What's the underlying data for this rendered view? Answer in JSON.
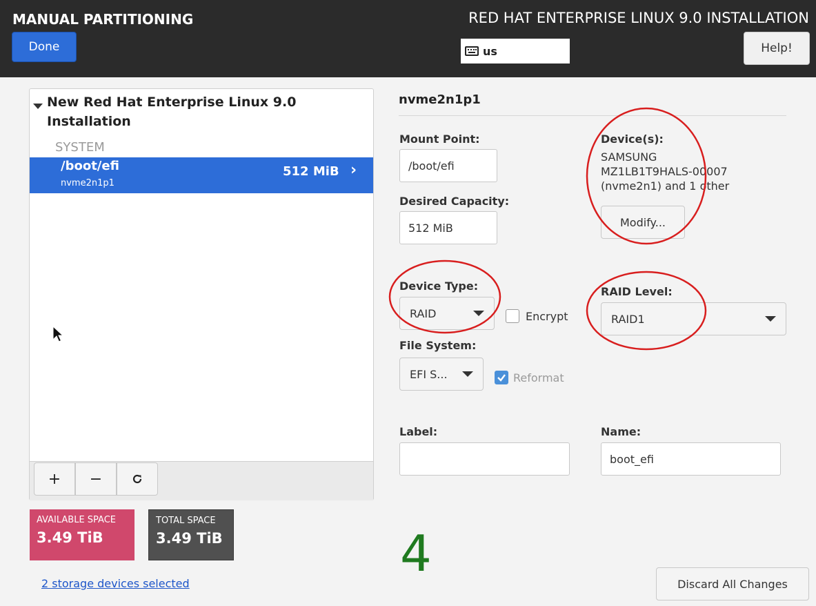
{
  "header": {
    "title": "MANUAL PARTITIONING",
    "product": "RED HAT ENTERPRISE LINUX 9.0 INSTALLATION",
    "done_label": "Done",
    "keyboard_layout": "us",
    "help_label": "Help!"
  },
  "tree": {
    "install_title": "New Red Hat Enterprise Linux 9.0 Installation",
    "group": "SYSTEM",
    "items": [
      {
        "mount": "/boot/efi",
        "device": "nvme2n1p1",
        "size": "512 MiB",
        "selected": true
      }
    ]
  },
  "toolbar": {
    "add": "+",
    "remove": "−",
    "reload": "↻"
  },
  "space": {
    "available_label": "AVAILABLE SPACE",
    "available_value": "3.49 TiB",
    "total_label": "TOTAL SPACE",
    "total_value": "3.49 TiB"
  },
  "storage_link": "2 storage devices selected",
  "details": {
    "title": "nvme2n1p1",
    "mount_point_label": "Mount Point:",
    "mount_point_value": "/boot/efi",
    "capacity_label": "Desired Capacity:",
    "capacity_value": "512 MiB",
    "devices_label": "Device(s):",
    "devices_line1": "SAMSUNG",
    "devices_line2": "MZ1LB1T9HALS-00007",
    "devices_line3": "(nvme2n1) and 1 other",
    "modify_label": "Modify...",
    "device_type_label": "Device Type:",
    "device_type_value": "RAID",
    "encrypt_label": "Encrypt",
    "encrypt_checked": false,
    "raid_level_label": "RAID Level:",
    "raid_level_value": "RAID1",
    "fs_label": "File System:",
    "fs_value": "EFI S...",
    "reformat_label": "Reformat",
    "reformat_checked": true,
    "label_label": "Label:",
    "label_value": "",
    "name_label": "Name:",
    "name_value": "boot_efi"
  },
  "annotation_number": "4",
  "discard_label": "Discard All Changes",
  "colors": {
    "header_bg": "#2b2b2b",
    "accent": "#2d6dd8",
    "available": "#d0486c",
    "total": "#505050",
    "annotation_red": "#d81e1e",
    "annotation_green": "#1f7a1f"
  }
}
